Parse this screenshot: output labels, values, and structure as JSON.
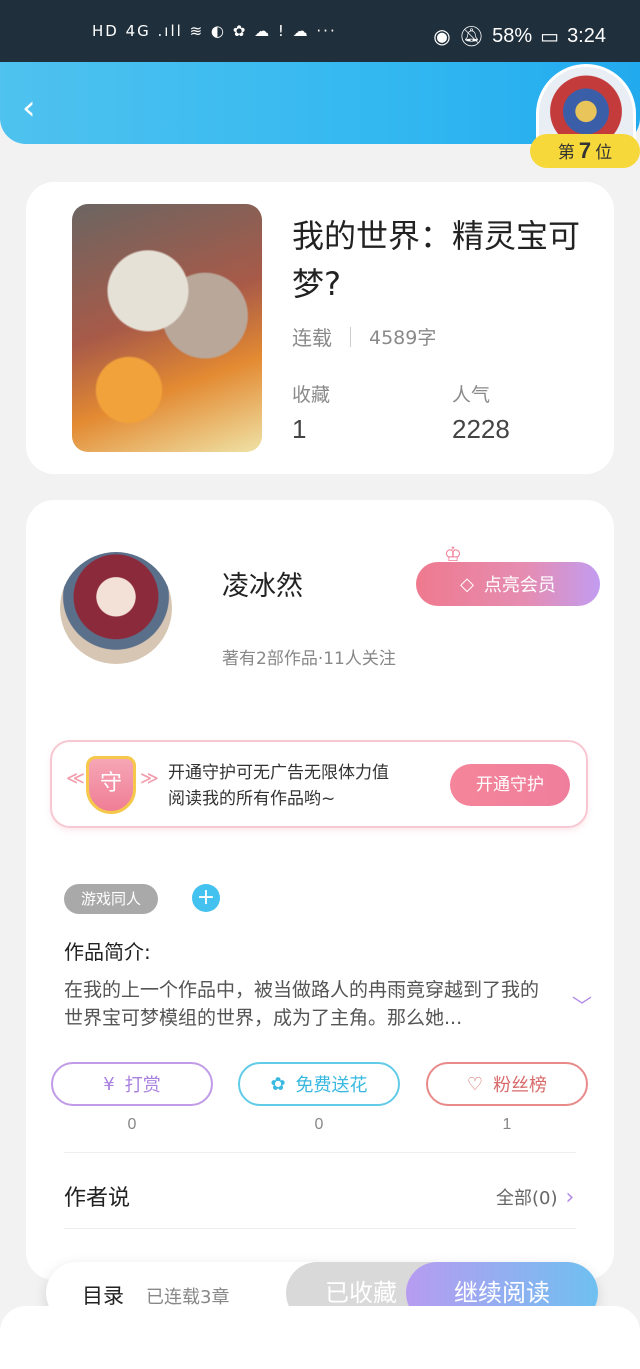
{
  "status_bar": {
    "left": "HD 4G .ıll ≋ ◐ ✿ ☁ ! ☁ ···",
    "battery": "58%",
    "time": "3:24"
  },
  "header": {
    "back_icon": "chevron-left-icon"
  },
  "rank": {
    "prefix": "第",
    "number": "7",
    "suffix": "位"
  },
  "book": {
    "title": "我的世界：精灵宝可梦?",
    "status": "连载",
    "word_count": "4589字",
    "favorites_label": "收藏",
    "favorites_value": "1",
    "popularity_label": "人气",
    "popularity_value": "2228"
  },
  "author": {
    "name": "凌冰然",
    "subtitle": "著有2部作品·11人关注",
    "vip_button": "点亮会员"
  },
  "guard": {
    "shield_char": "守",
    "text_line1": "开通守护可无广告无限体力值",
    "text_line2": "阅读我的所有作品哟~",
    "button": "开通守护"
  },
  "tags": {
    "tag1": "游戏同人",
    "add": "+"
  },
  "intro": {
    "label": "作品简介:",
    "text": "在我的上一个作品中，被当做路人的冉雨竟穿越到了我的世界宝可梦模组的世界，成为了主角。那么她..."
  },
  "actions": [
    {
      "label": "打赏",
      "icon": "yen-coin-icon",
      "count": "0"
    },
    {
      "label": "免费送花",
      "icon": "flower-icon",
      "count": "0"
    },
    {
      "label": "粉丝榜",
      "icon": "fans-heart-icon",
      "count": "1"
    }
  ],
  "author_says": {
    "label": "作者说",
    "all": "全部(0)"
  },
  "bottom_bar": {
    "toc": "目录",
    "serialized": "已连载3章",
    "favorited": "已收藏",
    "continue": "继续阅读"
  },
  "colors": {
    "header_blue": "#33b8f0",
    "accent_purple": "#b48ce6",
    "pink": "#ef7d95"
  }
}
